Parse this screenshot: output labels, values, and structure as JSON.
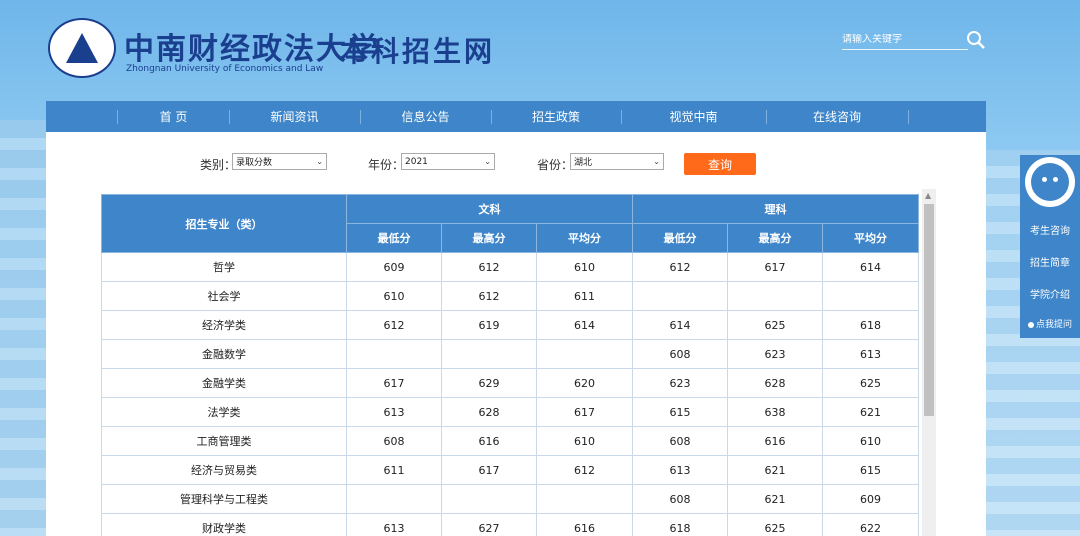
{
  "header": {
    "university_name": "中南财经政法大学",
    "university_en": "Zhongnan University of Economics and Law",
    "site_name": "本科招生网",
    "search_placeholder": "请输入关键字"
  },
  "nav": [
    "首 页",
    "新闻资讯",
    "信息公告",
    "招生政策",
    "视觉中南",
    "在线咨询"
  ],
  "filter": {
    "category_label": "类别：",
    "category_value": "录取分数",
    "year_label": "年份：",
    "year_value": "2021",
    "province_label": "省份：",
    "province_value": "湖北",
    "query_button": "查询"
  },
  "table": {
    "major_header": "招生专业（类）",
    "group_wen": "文科",
    "group_li": "理科",
    "sub_headers": [
      "最低分",
      "最高分",
      "平均分",
      "最低分",
      "最高分",
      "平均分"
    ],
    "rows": [
      {
        "major": "哲学",
        "cells": [
          "609",
          "612",
          "610",
          "612",
          "617",
          "614"
        ]
      },
      {
        "major": "社会学",
        "cells": [
          "610",
          "612",
          "611",
          "",
          "",
          ""
        ]
      },
      {
        "major": "经济学类",
        "cells": [
          "612",
          "619",
          "614",
          "614",
          "625",
          "618"
        ]
      },
      {
        "major": "金融数学",
        "cells": [
          "",
          "",
          "",
          "608",
          "623",
          "613"
        ]
      },
      {
        "major": "金融学类",
        "cells": [
          "617",
          "629",
          "620",
          "623",
          "628",
          "625"
        ]
      },
      {
        "major": "法学类",
        "cells": [
          "613",
          "628",
          "617",
          "615",
          "638",
          "621"
        ]
      },
      {
        "major": "工商管理类",
        "cells": [
          "608",
          "616",
          "610",
          "608",
          "616",
          "610"
        ]
      },
      {
        "major": "经济与贸易类",
        "cells": [
          "611",
          "617",
          "612",
          "613",
          "621",
          "615"
        ]
      },
      {
        "major": "管理科学与工程类",
        "cells": [
          "",
          "",
          "",
          "608",
          "621",
          "609"
        ]
      },
      {
        "major": "财政学类",
        "cells": [
          "613",
          "627",
          "616",
          "618",
          "625",
          "622"
        ]
      }
    ]
  },
  "side": {
    "items": [
      "考生咨询",
      "招生简章",
      "学院介绍",
      "点我提问"
    ]
  }
}
